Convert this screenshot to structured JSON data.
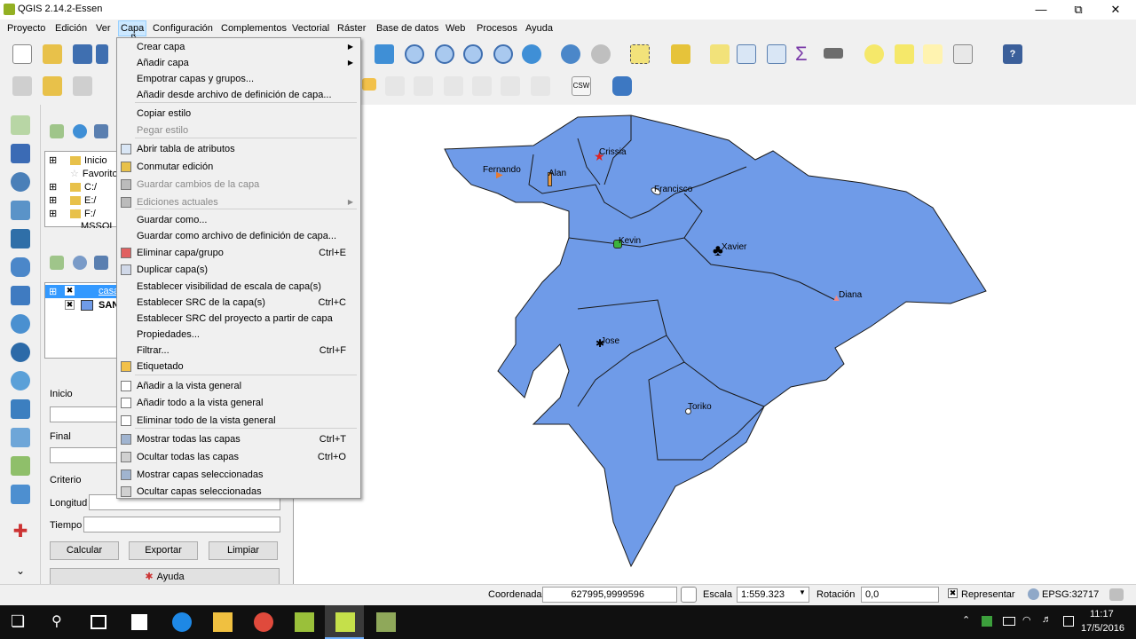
{
  "window": {
    "title": "QGIS 2.14.2-Essen"
  },
  "menubar": {
    "items": [
      "Proyecto",
      "Edición",
      "Ver",
      "Capa",
      "Configuración",
      "Complementos",
      "Vectorial",
      "Ráster",
      "Base de datos",
      "Web",
      "Procesos",
      "Ayuda"
    ]
  },
  "capa_menu": {
    "items": [
      {
        "label": "Crear capa",
        "shortcut": "",
        "submenu": true,
        "disabled": false
      },
      {
        "label": "Añadir capa",
        "shortcut": "",
        "submenu": true,
        "disabled": false
      },
      {
        "label": "Empotrar capas y grupos...",
        "shortcut": "",
        "submenu": false,
        "disabled": false
      },
      {
        "label": "Añadir desde archivo de definición de capa...",
        "shortcut": "",
        "submenu": false,
        "disabled": false
      },
      {
        "label": "Copiar estilo",
        "shortcut": "",
        "submenu": false,
        "disabled": false
      },
      {
        "label": "Pegar estilo",
        "shortcut": "",
        "submenu": false,
        "disabled": true
      },
      {
        "label": "Abrir tabla de atributos",
        "shortcut": "",
        "submenu": false,
        "disabled": false
      },
      {
        "label": "Conmutar edición",
        "shortcut": "",
        "submenu": false,
        "disabled": false
      },
      {
        "label": "Guardar cambios de la capa",
        "shortcut": "",
        "submenu": false,
        "disabled": true
      },
      {
        "label": "Ediciones actuales",
        "shortcut": "",
        "submenu": true,
        "disabled": true
      },
      {
        "label": "Guardar como...",
        "shortcut": "",
        "submenu": false,
        "disabled": false
      },
      {
        "label": "Guardar como archivo de definición de capa...",
        "shortcut": "",
        "submenu": false,
        "disabled": false
      },
      {
        "label": "Eliminar capa/grupo",
        "shortcut": "Ctrl+E",
        "submenu": false,
        "disabled": false
      },
      {
        "label": "Duplicar capa(s)",
        "shortcut": "",
        "submenu": false,
        "disabled": false
      },
      {
        "label": "Establecer visibilidad de escala de capa(s)",
        "shortcut": "",
        "submenu": false,
        "disabled": false
      },
      {
        "label": "Establecer SRC de la capa(s)",
        "shortcut": "Ctrl+C",
        "submenu": false,
        "disabled": false
      },
      {
        "label": "Establecer SRC del proyecto a partir de capa",
        "shortcut": "",
        "submenu": false,
        "disabled": false
      },
      {
        "label": "Propiedades...",
        "shortcut": "",
        "submenu": false,
        "disabled": false
      },
      {
        "label": "Filtrar...",
        "shortcut": "Ctrl+F",
        "submenu": false,
        "disabled": false
      },
      {
        "label": "Etiquetado",
        "shortcut": "",
        "submenu": false,
        "disabled": false
      },
      {
        "label": "Añadir a la vista general",
        "shortcut": "",
        "submenu": false,
        "disabled": false
      },
      {
        "label": "Añadir todo a la vista general",
        "shortcut": "",
        "submenu": false,
        "disabled": false
      },
      {
        "label": "Eliminar todo de la vista general",
        "shortcut": "",
        "submenu": false,
        "disabled": false
      },
      {
        "label": "Mostrar todas las capas",
        "shortcut": "Ctrl+T",
        "submenu": false,
        "disabled": false
      },
      {
        "label": "Ocultar todas las capas",
        "shortcut": "Ctrl+O",
        "submenu": false,
        "disabled": false
      },
      {
        "label": "Mostrar capas seleccionadas",
        "shortcut": "",
        "submenu": false,
        "disabled": false
      },
      {
        "label": "Ocultar capas seleccionadas",
        "shortcut": "",
        "submenu": false,
        "disabled": false
      }
    ]
  },
  "browser": {
    "items": [
      "Inicio",
      "Favoritos",
      "C:/",
      "E:/",
      "F:/",
      "MSSQL"
    ]
  },
  "layers": {
    "items": [
      "casa",
      "SAN"
    ]
  },
  "route_panel": {
    "start_label": "Inicio",
    "end_label": "Final",
    "criteria_label": "Criterio",
    "length_label": "Longitud",
    "time_label": "Tiempo",
    "calc_button": "Calcular",
    "export_button": "Exportar",
    "clear_button": "Limpiar",
    "help_button": "Ayuda"
  },
  "map": {
    "fill_color": "#6f9be8",
    "labels": [
      "Fernando",
      "Alan",
      "Crissia",
      "Francisco",
      "Kevin",
      "Xavier",
      "Diana",
      "Jose",
      "Toriko"
    ]
  },
  "statusbar": {
    "coord_label": "Coordenada",
    "coord_value": "627995,9999596",
    "scale_label": "Escala",
    "scale_value": "1:559.323",
    "rotation_label": "Rotación",
    "rotation_value": "0,0",
    "render_label": "Representar",
    "crs_label": "EPSG:32717"
  },
  "taskbar": {
    "time": "11:17",
    "date": "17/5/2016"
  }
}
